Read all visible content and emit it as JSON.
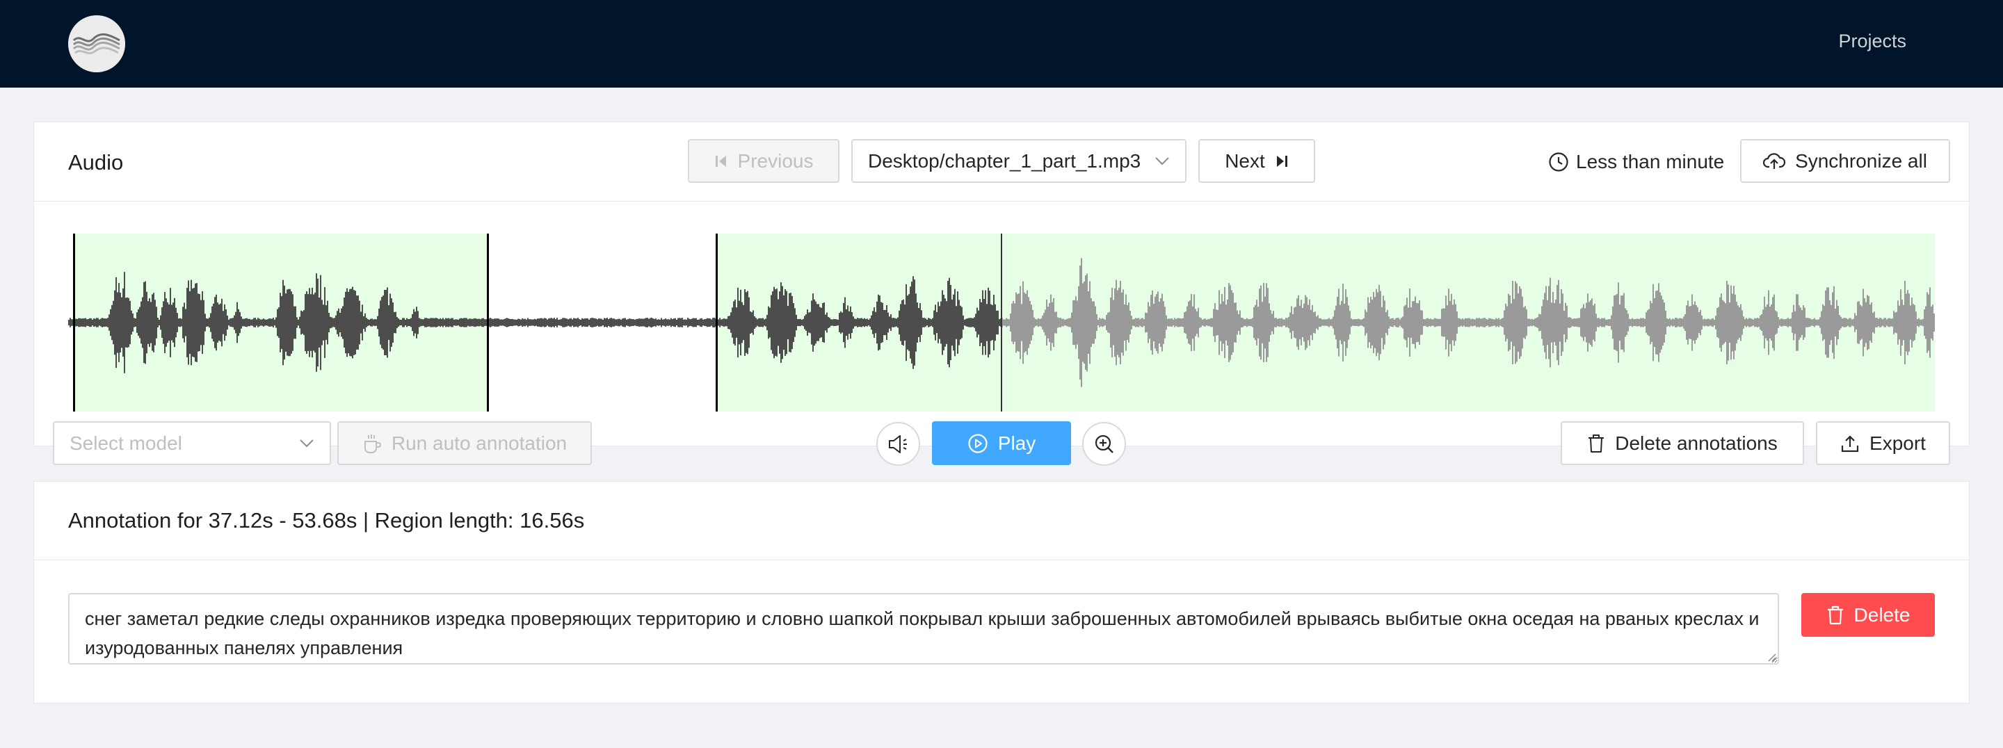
{
  "header": {
    "nav_projects": "Projects"
  },
  "audio_card": {
    "title": "Audio",
    "previous_label": "Previous",
    "file_selected": "Desktop/chapter_1_part_1.mp3",
    "next_label": "Next",
    "duration_text": "Less than minute",
    "sync_label": "Synchronize all"
  },
  "controls": {
    "model_placeholder": "Select model",
    "auto_annotation_label": "Run auto annotation",
    "play_label": "Play",
    "delete_annotations_label": "Delete annotations",
    "export_label": "Export"
  },
  "annotation_card": {
    "title": "Annotation for 37.12s - 53.68s | Region length: 16.56s",
    "text": "снег заметал редкие следы охранников изредка проверяющих территорию и словно шапкой покрывал крыши заброшенных автомобилей врываясь выбитые окна оседая на рваных креслах и изуродованных панелях управления",
    "delete_label": "Delete"
  },
  "colors": {
    "header_bg": "#001529",
    "region_fill": "#e6fde6",
    "wave_played": "#4d4d4d",
    "wave_unplayed": "#9a9a9a",
    "primary": "#40a9ff",
    "danger": "#ff4d4f"
  }
}
